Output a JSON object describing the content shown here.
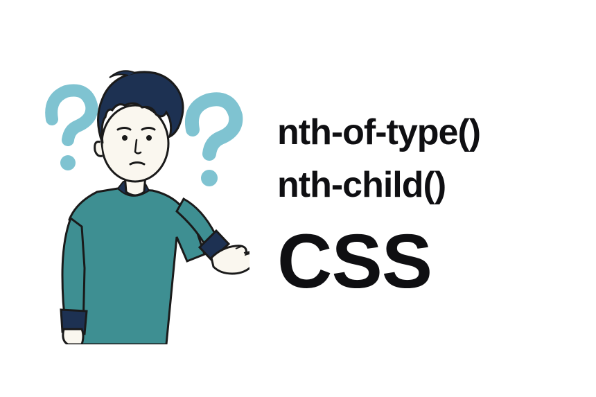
{
  "text": {
    "line1": "nth-of-type()",
    "line2": "nth-child()",
    "line3": "CSS"
  },
  "illustration": {
    "description": "confused-person",
    "accent_color": "#7fc3d1",
    "dark_color": "#1d3152",
    "hair_color": "#1d3152",
    "shirt_color": "#3e8f92",
    "sleeve_color": "#1d3152",
    "skin_color": "#faf7ef",
    "outline_color": "#1a1a1a"
  }
}
